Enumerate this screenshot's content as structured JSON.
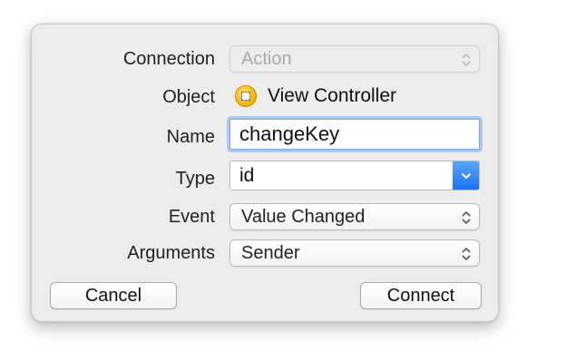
{
  "dialog": {
    "connection": {
      "label": "Connection",
      "value": "Action"
    },
    "object": {
      "label": "Object",
      "value": "View Controller",
      "icon": "view-controller-icon"
    },
    "name": {
      "label": "Name",
      "value": "changeKey"
    },
    "type": {
      "label": "Type",
      "value": "id"
    },
    "event": {
      "label": "Event",
      "value": "Value Changed"
    },
    "arguments": {
      "label": "Arguments",
      "value": "Sender"
    },
    "buttons": {
      "cancel": "Cancel",
      "connect": "Connect"
    }
  },
  "colors": {
    "accent": "#1c6ff0",
    "focus_ring": "#a9c9ef",
    "icon_yellow": "#f1b300"
  }
}
